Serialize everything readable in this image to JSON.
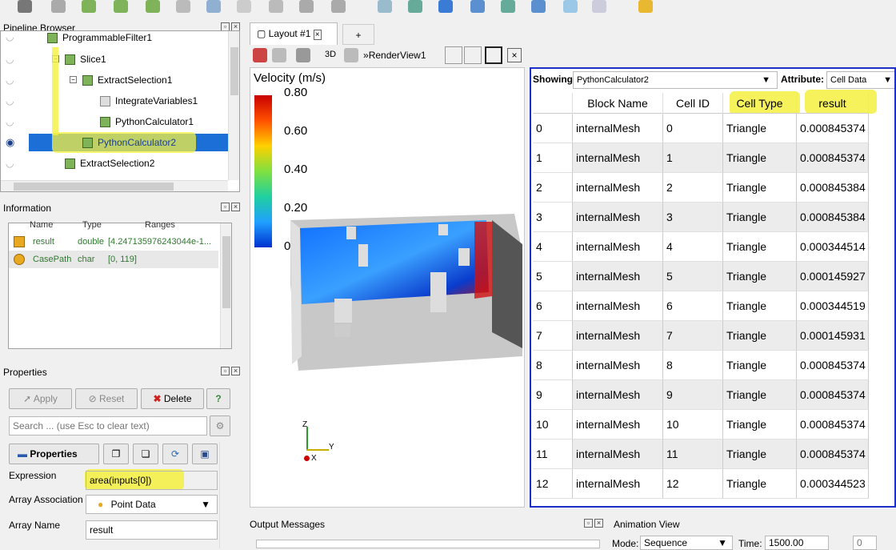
{
  "pipeline": {
    "title": "Pipeline Browser",
    "items": [
      {
        "label": "ProgrammableFilter1"
      },
      {
        "label": "Slice1"
      },
      {
        "label": "ExtractSelection1"
      },
      {
        "label": "IntegrateVariables1"
      },
      {
        "label": "PythonCalculator1"
      },
      {
        "label": "PythonCalculator2"
      },
      {
        "label": "ExtractSelection2"
      }
    ]
  },
  "information": {
    "title": "Information",
    "columns": [
      "Name",
      "Type",
      "Ranges"
    ],
    "rows": [
      {
        "name": "result",
        "type": "double",
        "range": "[4.247135976243044e-1..."
      },
      {
        "name": "CasePath",
        "type": "char",
        "range": "[0, 119]"
      }
    ]
  },
  "properties": {
    "title": "Properties",
    "apply": "Apply",
    "reset": "Reset",
    "delete": "Delete",
    "help": "?",
    "search_placeholder": "Search ... (use Esc to clear text)",
    "section": "Properties",
    "expression_label": "Expression",
    "expression_value": "area(inputs[0])",
    "array_assoc_label": "Array Association",
    "array_assoc_value": "Point Data",
    "array_name_label": "Array Name",
    "array_name_value": "result"
  },
  "layout": {
    "tab": "Layout #1",
    "add": "+",
    "mode3d": "3D",
    "view_name": "RenderView1"
  },
  "render": {
    "colorbar_title": "Velocity (m/s)",
    "ticks": [
      "0.80",
      "0.60",
      "0.40",
      "0.20",
      "0.00"
    ],
    "axis_z": "Z",
    "axis_y": "Y",
    "axis_x": "X"
  },
  "sheet": {
    "showing_label": "Showing",
    "showing_value": "PythonCalculator2",
    "attribute_label": "Attribute:",
    "attribute_value": "Cell Data",
    "columns": [
      "Block Name",
      "Cell ID",
      "Cell Type",
      "result"
    ],
    "rows": [
      [
        "0",
        "internalMesh",
        "0",
        "Triangle",
        "0.000845374"
      ],
      [
        "1",
        "internalMesh",
        "1",
        "Triangle",
        "0.000845374"
      ],
      [
        "2",
        "internalMesh",
        "2",
        "Triangle",
        "0.000845384"
      ],
      [
        "3",
        "internalMesh",
        "3",
        "Triangle",
        "0.000845384"
      ],
      [
        "4",
        "internalMesh",
        "4",
        "Triangle",
        "0.000344514"
      ],
      [
        "5",
        "internalMesh",
        "5",
        "Triangle",
        "0.000145927"
      ],
      [
        "6",
        "internalMesh",
        "6",
        "Triangle",
        "0.000344519"
      ],
      [
        "7",
        "internalMesh",
        "7",
        "Triangle",
        "0.000145931"
      ],
      [
        "8",
        "internalMesh",
        "8",
        "Triangle",
        "0.000845374"
      ],
      [
        "9",
        "internalMesh",
        "9",
        "Triangle",
        "0.000845374"
      ],
      [
        "10",
        "internalMesh",
        "10",
        "Triangle",
        "0.000845374"
      ],
      [
        "11",
        "internalMesh",
        "11",
        "Triangle",
        "0.000845374"
      ],
      [
        "12",
        "internalMesh",
        "12",
        "Triangle",
        "0.000344523"
      ]
    ]
  },
  "bottom": {
    "output_messages": "Output Messages",
    "animation_view": "Animation View",
    "mode_label": "Mode:",
    "mode_value": "Sequence",
    "time_label": "Time:",
    "time_value": "1500.00",
    "frame_value": "0"
  },
  "colors": {
    "highlight": "#f4f040",
    "selection": "#1c6fd6",
    "accent_border": "#1c2fc8"
  }
}
